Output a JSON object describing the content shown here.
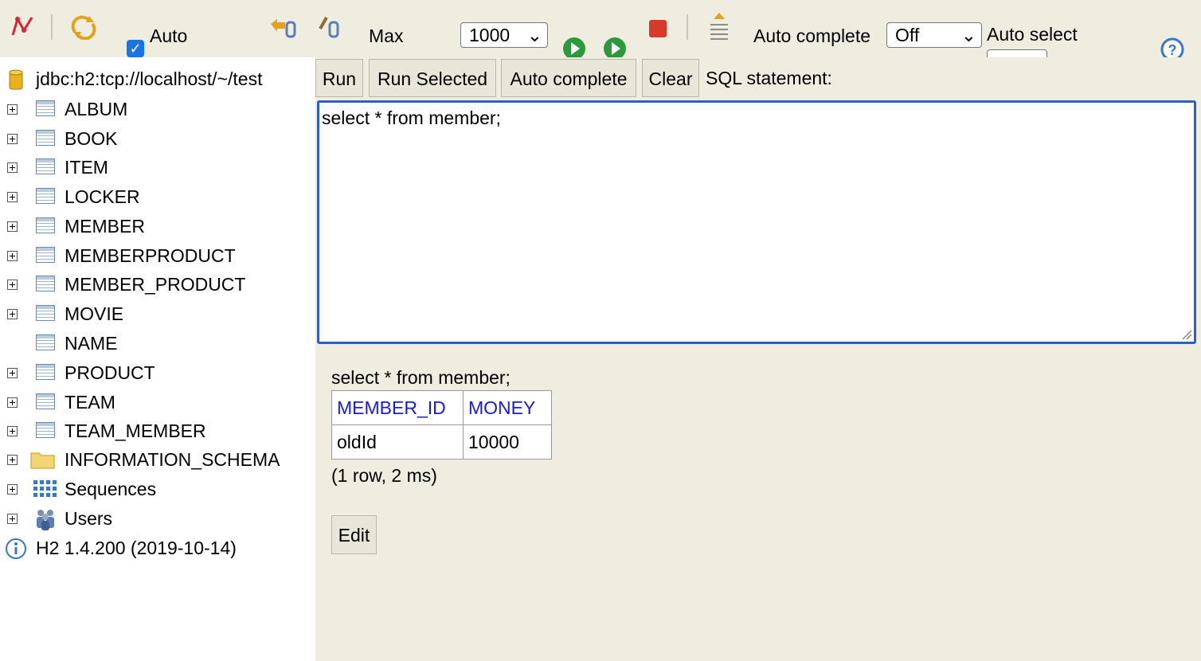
{
  "toolbar": {
    "auto_commit_label": "Auto",
    "max_label": "Max",
    "max_rows_value": "1000",
    "auto_complete_label": "Auto complete",
    "auto_complete_value": "Off",
    "auto_select_label": "Auto select",
    "icons": [
      "disconnect-icon",
      "refresh-icon",
      "rollback-icon",
      "commit-icon",
      "run-icon",
      "run-selected-icon",
      "stop-icon",
      "history-icon",
      "help-icon"
    ]
  },
  "tree": {
    "connection": "jdbc:h2:tcp://localhost/~/test",
    "tables": [
      "ALBUM",
      "BOOK",
      "ITEM",
      "LOCKER",
      "MEMBER",
      "MEMBERPRODUCT",
      "MEMBER_PRODUCT",
      "MOVIE",
      "NAME",
      "PRODUCT",
      "TEAM",
      "TEAM_MEMBER"
    ],
    "schema": "INFORMATION_SCHEMA",
    "sequences": "Sequences",
    "users": "Users",
    "version": "H2 1.4.200 (2019-10-14)"
  },
  "main": {
    "buttons": {
      "run": "Run",
      "run_selected": "Run Selected",
      "auto_complete": "Auto complete",
      "clear": "Clear"
    },
    "sql_label": "SQL statement:",
    "sql_text": "select * from member;",
    "result": {
      "query": "select * from member;",
      "columns": [
        "MEMBER_ID",
        "MONEY"
      ],
      "rows": [
        [
          "oldId",
          "10000"
        ]
      ],
      "summary": "(1 row, 2 ms)",
      "edit_button": "Edit"
    }
  },
  "colors": {
    "panel_bg": "#efede0",
    "link_blue": "#1a1ae6",
    "editor_border": "#2f5fbf"
  }
}
